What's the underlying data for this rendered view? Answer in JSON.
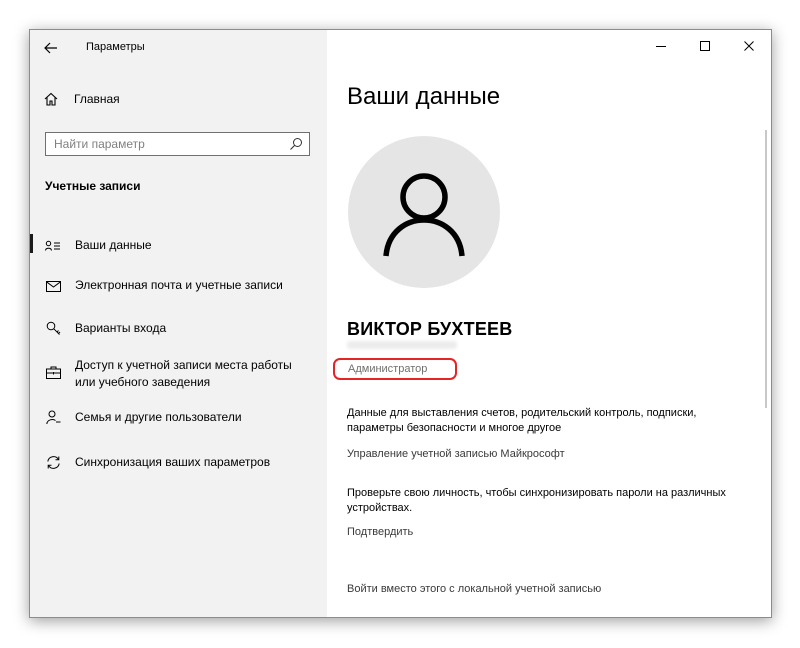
{
  "window": {
    "title": "Параметры",
    "back_label": "←"
  },
  "sidebar": {
    "home_label": "Главная",
    "search_placeholder": "Найти параметр",
    "section_title": "Учетные записи",
    "items": [
      {
        "label": "Ваши данные",
        "icon": "user-card-icon",
        "active": true
      },
      {
        "label": "Электронная почта и учетные записи",
        "icon": "mail-icon",
        "active": false
      },
      {
        "label": "Варианты входа",
        "icon": "key-icon",
        "active": false
      },
      {
        "label": "Доступ к учетной записи места работы или учебного заведения",
        "icon": "briefcase-icon",
        "active": false
      },
      {
        "label": "Семья и другие пользователи",
        "icon": "person-add-icon",
        "active": false
      },
      {
        "label": "Синхронизация ваших параметров",
        "icon": "sync-icon",
        "active": false
      }
    ]
  },
  "main": {
    "title": "Ваши данные",
    "user_name": "ВИКТОР БУХТЕЕВ",
    "role": "Администратор",
    "billing_desc": "Данные для выставления счетов, родительский контроль, подписки, параметры безопасности и многое другое",
    "manage_link": "Управление учетной записью Майкрософт",
    "verify_desc": "Проверьте свою личность, чтобы синхронизировать пароли на различных устройствах.",
    "verify_link": "Подтвердить",
    "local_link": "Войти вместо этого с локальной учетной записью"
  },
  "colors": {
    "highlight": "#e52426",
    "sidebar_bg": "#f2f2f2",
    "avatar_bg": "#e5e5e5"
  }
}
